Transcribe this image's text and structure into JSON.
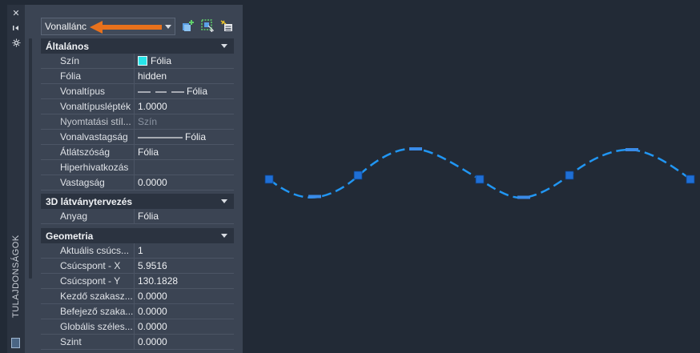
{
  "palette_strip": {
    "title": "TULAJDONSÁGOK",
    "icons": [
      "close-icon",
      "collapse-icon",
      "settings-icon",
      "properties-icon"
    ]
  },
  "selector": {
    "value": "Vonallánc",
    "toolbar_icons": [
      "quick-select-icon",
      "select-objects-icon",
      "toggle-pickadd-icon"
    ]
  },
  "accent": {
    "highlight": "#e8711c",
    "cyan": "#27e5ea",
    "grip": "#1f6fd6",
    "selection": "#2196f3"
  },
  "sections": {
    "general": {
      "title": "Általános",
      "rows": [
        {
          "label": "Szín",
          "value": "Fólia"
        },
        {
          "label": "Fólia",
          "value": "hidden"
        },
        {
          "label": "Vonaltípus",
          "value": "Fólia"
        },
        {
          "label": "Vonaltípuslépték",
          "value": "1.0000"
        },
        {
          "label": "Nyomtatási stíl...",
          "value": "Szín"
        },
        {
          "label": "Vonalvastagság",
          "value": "Fólia"
        },
        {
          "label": "Átlátszóság",
          "value": "Fólia"
        },
        {
          "label": "Hiperhivatkozás",
          "value": ""
        },
        {
          "label": "Vastagság",
          "value": "0.0000"
        }
      ]
    },
    "viz3d": {
      "title": "3D látványtervezés",
      "rows": [
        {
          "label": "Anyag",
          "value": "Fólia"
        }
      ]
    },
    "geometry": {
      "title": "Geometria",
      "rows": [
        {
          "label": "Aktuális csúcs...",
          "value": "1"
        },
        {
          "label": "Csúcspont - X",
          "value": "5.9516"
        },
        {
          "label": "Csúcspont - Y",
          "value": "130.1828"
        },
        {
          "label": "Kezdő szakasz...",
          "value": "0.0000"
        },
        {
          "label": "Befejező szaka...",
          "value": "0.0000"
        },
        {
          "label": "Globális széles...",
          "value": "0.0000"
        },
        {
          "label": "Szint",
          "value": "0.0000"
        }
      ]
    }
  }
}
